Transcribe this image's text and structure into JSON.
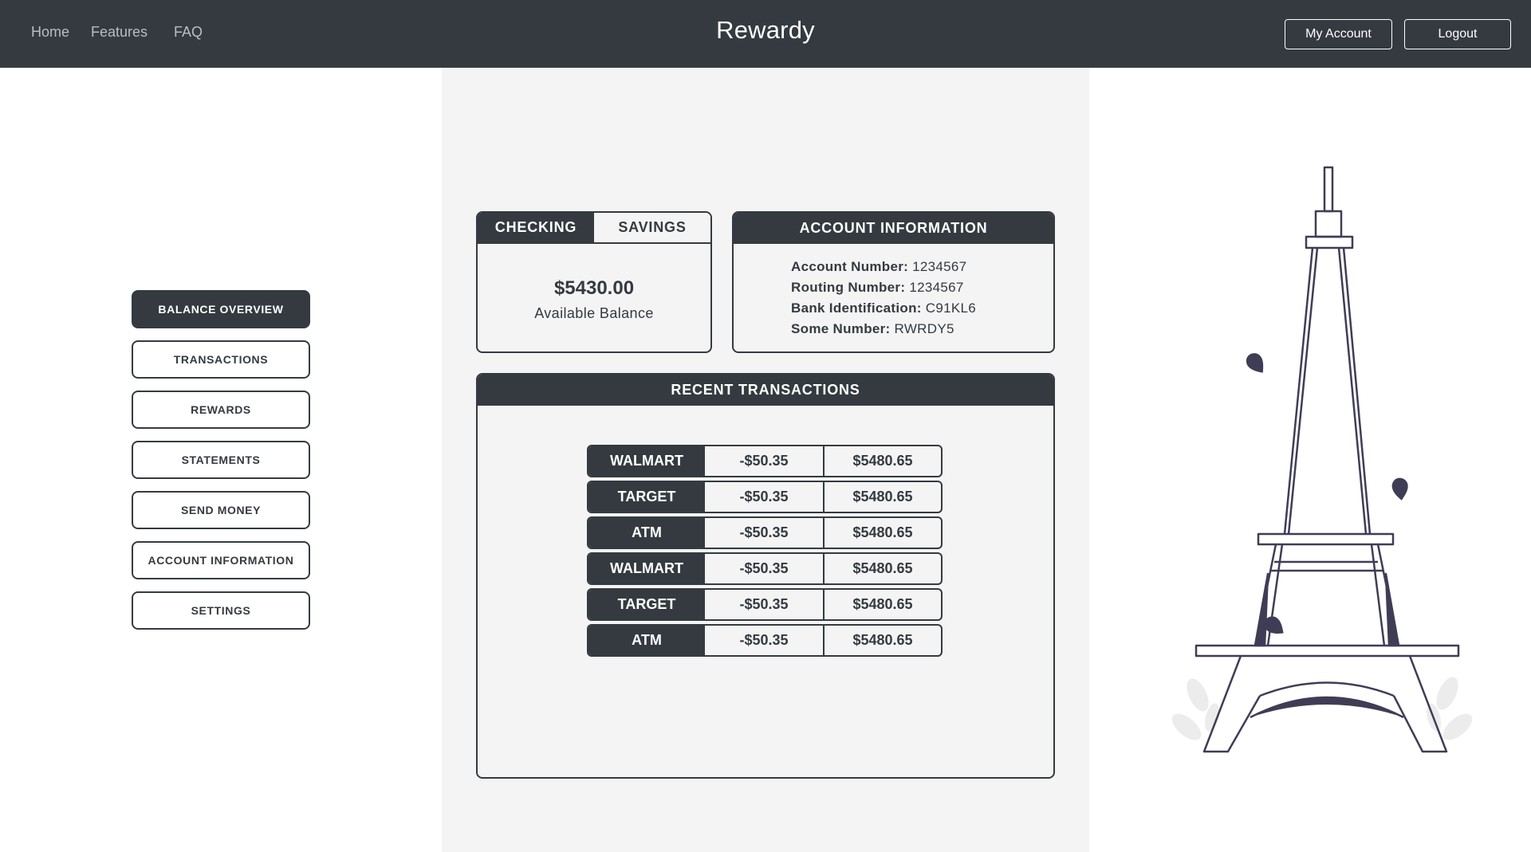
{
  "nav": {
    "links": [
      "Home",
      "Features",
      "FAQ"
    ],
    "brand": "Rewardy",
    "my_account": "My Account",
    "logout": "Logout"
  },
  "sidebar": {
    "items": [
      {
        "label": "BALANCE OVERVIEW",
        "active": true
      },
      {
        "label": "TRANSACTIONS",
        "active": false
      },
      {
        "label": "REWARDS",
        "active": false
      },
      {
        "label": "STATEMENTS",
        "active": false
      },
      {
        "label": "SEND MONEY",
        "active": false
      },
      {
        "label": "ACCOUNT INFORMATION",
        "active": false
      },
      {
        "label": "SETTINGS",
        "active": false
      }
    ]
  },
  "balance_card": {
    "tabs": [
      {
        "label": "CHECKING",
        "active": true
      },
      {
        "label": "SAVINGS",
        "active": false
      }
    ],
    "amount": "$5430.00",
    "label": "Available Balance"
  },
  "account_info": {
    "title": "ACCOUNT INFORMATION",
    "rows": [
      {
        "label": "Account Number:",
        "value": "1234567"
      },
      {
        "label": "Routing Number:",
        "value": "1234567"
      },
      {
        "label": "Bank Identification:",
        "value": "C91KL6"
      },
      {
        "label": "Some Number:",
        "value": "RWRDY5"
      }
    ]
  },
  "transactions": {
    "title": "RECENT TRANSACTIONS",
    "rows": [
      {
        "merchant": "WALMART",
        "amount": "-$50.35",
        "balance": "$5480.65"
      },
      {
        "merchant": "TARGET",
        "amount": "-$50.35",
        "balance": "$5480.65"
      },
      {
        "merchant": "ATM",
        "amount": "-$50.35",
        "balance": "$5480.65"
      },
      {
        "merchant": "WALMART",
        "amount": "-$50.35",
        "balance": "$5480.65"
      },
      {
        "merchant": "TARGET",
        "amount": "-$50.35",
        "balance": "$5480.65"
      },
      {
        "merchant": "ATM",
        "amount": "-$50.35",
        "balance": "$5480.65"
      }
    ]
  },
  "illustration": {
    "icon": "eiffel-tower-icon",
    "accent": "#343a40"
  }
}
